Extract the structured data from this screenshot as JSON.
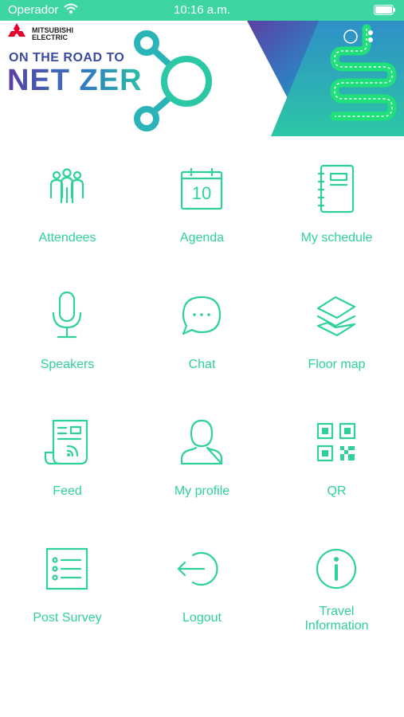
{
  "status_bar": {
    "carrier": "Operador",
    "time": "10:16 a.m."
  },
  "banner": {
    "brand_line1": "MITSUBISHI",
    "brand_line2": "ELECTRIC",
    "headline_top": "ON THE ROAD TO",
    "headline_main": "NET ZER"
  },
  "menu": [
    {
      "label": "Attendees",
      "icon": "attendees-icon"
    },
    {
      "label": "Agenda",
      "icon": "calendar-icon",
      "icon_text": "10"
    },
    {
      "label": "My schedule",
      "icon": "notebook-icon"
    },
    {
      "label": "Speakers",
      "icon": "microphone-icon"
    },
    {
      "label": "Chat",
      "icon": "chat-bubble-icon",
      "icon_text": "..."
    },
    {
      "label": "Floor map",
      "icon": "layers-icon"
    },
    {
      "label": "Feed",
      "icon": "news-feed-icon"
    },
    {
      "label": "My profile",
      "icon": "user-icon"
    },
    {
      "label": "QR",
      "icon": "qr-code-icon"
    },
    {
      "label": "Post Survey",
      "icon": "survey-list-icon"
    },
    {
      "label": "Logout",
      "icon": "logout-icon"
    },
    {
      "label": "Travel Information",
      "label_line1": "Travel",
      "label_line2": "Information",
      "icon": "info-icon"
    }
  ],
  "colors": {
    "accent": "#2fd19b",
    "status_bar": "#3dd6a0",
    "headline": "#3a4aa0"
  }
}
